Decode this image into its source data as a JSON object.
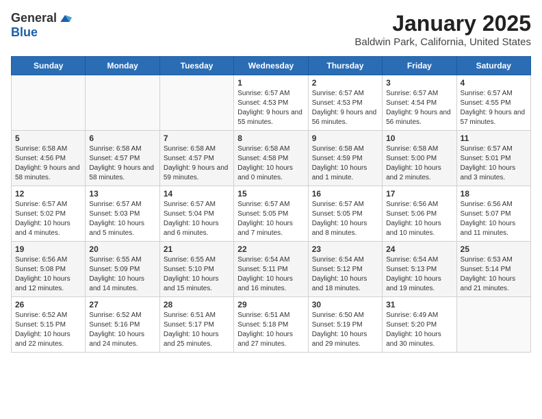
{
  "header": {
    "logo_general": "General",
    "logo_blue": "Blue",
    "month_title": "January 2025",
    "location": "Baldwin Park, California, United States"
  },
  "days_of_week": [
    "Sunday",
    "Monday",
    "Tuesday",
    "Wednesday",
    "Thursday",
    "Friday",
    "Saturday"
  ],
  "weeks": [
    [
      {
        "day": "",
        "info": ""
      },
      {
        "day": "",
        "info": ""
      },
      {
        "day": "",
        "info": ""
      },
      {
        "day": "1",
        "info": "Sunrise: 6:57 AM\nSunset: 4:53 PM\nDaylight: 9 hours and 55 minutes."
      },
      {
        "day": "2",
        "info": "Sunrise: 6:57 AM\nSunset: 4:53 PM\nDaylight: 9 hours and 56 minutes."
      },
      {
        "day": "3",
        "info": "Sunrise: 6:57 AM\nSunset: 4:54 PM\nDaylight: 9 hours and 56 minutes."
      },
      {
        "day": "4",
        "info": "Sunrise: 6:57 AM\nSunset: 4:55 PM\nDaylight: 9 hours and 57 minutes."
      }
    ],
    [
      {
        "day": "5",
        "info": "Sunrise: 6:58 AM\nSunset: 4:56 PM\nDaylight: 9 hours and 58 minutes."
      },
      {
        "day": "6",
        "info": "Sunrise: 6:58 AM\nSunset: 4:57 PM\nDaylight: 9 hours and 58 minutes."
      },
      {
        "day": "7",
        "info": "Sunrise: 6:58 AM\nSunset: 4:57 PM\nDaylight: 9 hours and 59 minutes."
      },
      {
        "day": "8",
        "info": "Sunrise: 6:58 AM\nSunset: 4:58 PM\nDaylight: 10 hours and 0 minutes."
      },
      {
        "day": "9",
        "info": "Sunrise: 6:58 AM\nSunset: 4:59 PM\nDaylight: 10 hours and 1 minute."
      },
      {
        "day": "10",
        "info": "Sunrise: 6:58 AM\nSunset: 5:00 PM\nDaylight: 10 hours and 2 minutes."
      },
      {
        "day": "11",
        "info": "Sunrise: 6:57 AM\nSunset: 5:01 PM\nDaylight: 10 hours and 3 minutes."
      }
    ],
    [
      {
        "day": "12",
        "info": "Sunrise: 6:57 AM\nSunset: 5:02 PM\nDaylight: 10 hours and 4 minutes."
      },
      {
        "day": "13",
        "info": "Sunrise: 6:57 AM\nSunset: 5:03 PM\nDaylight: 10 hours and 5 minutes."
      },
      {
        "day": "14",
        "info": "Sunrise: 6:57 AM\nSunset: 5:04 PM\nDaylight: 10 hours and 6 minutes."
      },
      {
        "day": "15",
        "info": "Sunrise: 6:57 AM\nSunset: 5:05 PM\nDaylight: 10 hours and 7 minutes."
      },
      {
        "day": "16",
        "info": "Sunrise: 6:57 AM\nSunset: 5:05 PM\nDaylight: 10 hours and 8 minutes."
      },
      {
        "day": "17",
        "info": "Sunrise: 6:56 AM\nSunset: 5:06 PM\nDaylight: 10 hours and 10 minutes."
      },
      {
        "day": "18",
        "info": "Sunrise: 6:56 AM\nSunset: 5:07 PM\nDaylight: 10 hours and 11 minutes."
      }
    ],
    [
      {
        "day": "19",
        "info": "Sunrise: 6:56 AM\nSunset: 5:08 PM\nDaylight: 10 hours and 12 minutes."
      },
      {
        "day": "20",
        "info": "Sunrise: 6:55 AM\nSunset: 5:09 PM\nDaylight: 10 hours and 14 minutes."
      },
      {
        "day": "21",
        "info": "Sunrise: 6:55 AM\nSunset: 5:10 PM\nDaylight: 10 hours and 15 minutes."
      },
      {
        "day": "22",
        "info": "Sunrise: 6:54 AM\nSunset: 5:11 PM\nDaylight: 10 hours and 16 minutes."
      },
      {
        "day": "23",
        "info": "Sunrise: 6:54 AM\nSunset: 5:12 PM\nDaylight: 10 hours and 18 minutes."
      },
      {
        "day": "24",
        "info": "Sunrise: 6:54 AM\nSunset: 5:13 PM\nDaylight: 10 hours and 19 minutes."
      },
      {
        "day": "25",
        "info": "Sunrise: 6:53 AM\nSunset: 5:14 PM\nDaylight: 10 hours and 21 minutes."
      }
    ],
    [
      {
        "day": "26",
        "info": "Sunrise: 6:52 AM\nSunset: 5:15 PM\nDaylight: 10 hours and 22 minutes."
      },
      {
        "day": "27",
        "info": "Sunrise: 6:52 AM\nSunset: 5:16 PM\nDaylight: 10 hours and 24 minutes."
      },
      {
        "day": "28",
        "info": "Sunrise: 6:51 AM\nSunset: 5:17 PM\nDaylight: 10 hours and 25 minutes."
      },
      {
        "day": "29",
        "info": "Sunrise: 6:51 AM\nSunset: 5:18 PM\nDaylight: 10 hours and 27 minutes."
      },
      {
        "day": "30",
        "info": "Sunrise: 6:50 AM\nSunset: 5:19 PM\nDaylight: 10 hours and 29 minutes."
      },
      {
        "day": "31",
        "info": "Sunrise: 6:49 AM\nSunset: 5:20 PM\nDaylight: 10 hours and 30 minutes."
      },
      {
        "day": "",
        "info": ""
      }
    ]
  ]
}
